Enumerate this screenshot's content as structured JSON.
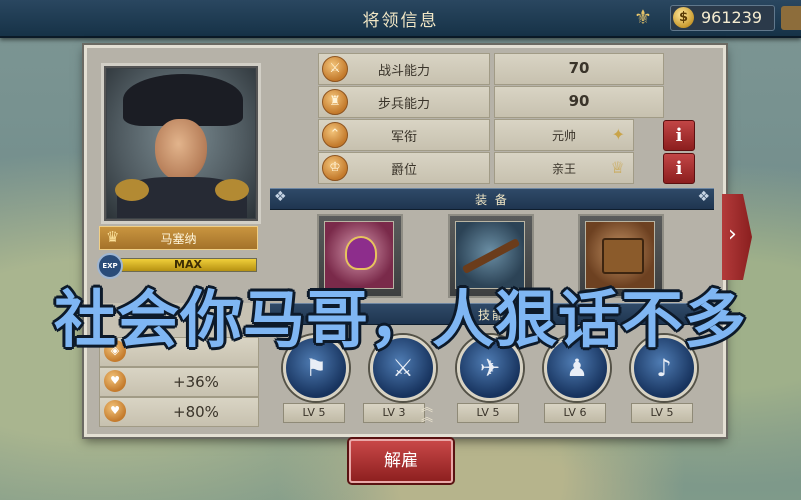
{
  "header": {
    "title": "将领信息",
    "settings_icon": "fleur-icon",
    "gold_amount": "961239",
    "gold_icon": "coin-icon"
  },
  "general": {
    "name": "马塞纳",
    "exp_label": "EXP",
    "exp_value": "MAX",
    "exp_progress": 1.0
  },
  "stats": [
    {
      "label": "战斗能力",
      "value": "70",
      "icon": "swords-icon"
    },
    {
      "label": "步兵能力",
      "value": "90",
      "icon": "infantry-icon"
    },
    {
      "label": "军衔",
      "value": "元帅",
      "icon": "rank-icon",
      "has_info": true
    },
    {
      "label": "爵位",
      "value": "亲王",
      "icon": "nobility-icon",
      "has_info": true
    }
  ],
  "info_button_label": "i",
  "equipment": {
    "section_title": "装 备",
    "items": [
      {
        "name": "medal-item",
        "icon": "purple-heart-medal-icon"
      },
      {
        "name": "musket-item",
        "icon": "musket-icon"
      },
      {
        "name": "ammo-box-item",
        "icon": "ammo-chest-icon"
      }
    ]
  },
  "skills": {
    "section_title": "技能",
    "items": [
      {
        "icon": "charge-icon",
        "level": "LV 5"
      },
      {
        "icon": "volley-icon",
        "level": "LV 3",
        "upgradable": true
      },
      {
        "icon": "rifleman-icon",
        "level": "LV 5"
      },
      {
        "icon": "laurel-general-icon",
        "level": "LV 6"
      },
      {
        "icon": "bugle-icon",
        "level": "LV 5"
      }
    ]
  },
  "bonuses": [
    {
      "value": "+36%",
      "icon": "heart-shield-icon"
    },
    {
      "value": "+80%",
      "icon": "heart-icon"
    }
  ],
  "dismiss_button": "解雇",
  "overlay_caption": "社会你马哥，人狠话不多",
  "colors": {
    "accent_red": "#b33a3a",
    "gold": "#c9953f",
    "navy": "#1f3550"
  }
}
